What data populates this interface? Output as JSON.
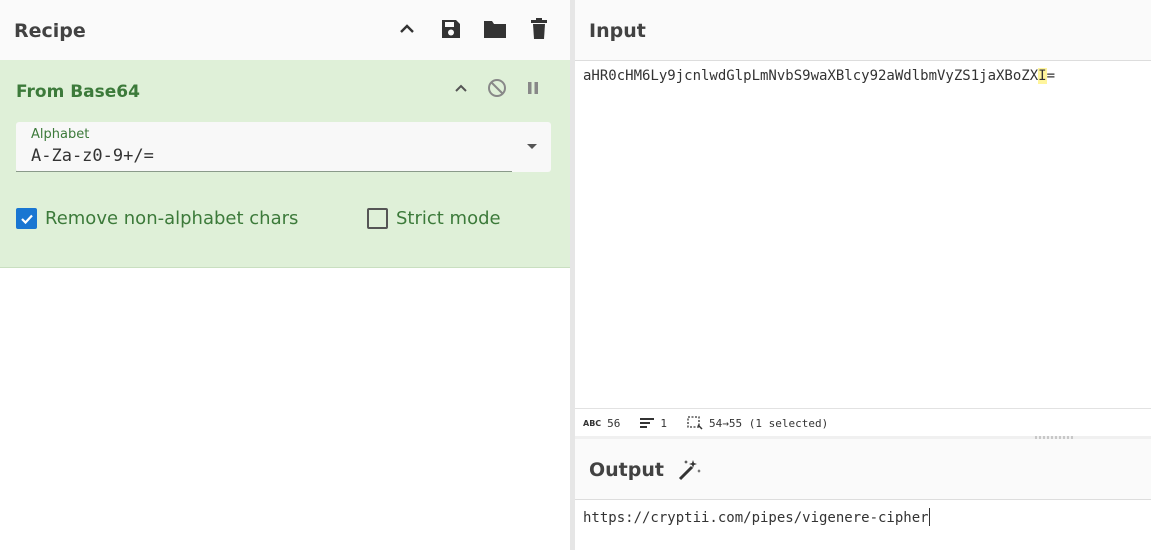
{
  "recipe": {
    "title": "Recipe",
    "icons": [
      "chevron-up-icon",
      "save-icon",
      "folder-icon",
      "trash-icon"
    ]
  },
  "operation": {
    "title": "From Base64",
    "alphabet_label": "Alphabet",
    "alphabet_value": "A-Za-z0-9+/=",
    "remove_non_alphabet_label": "Remove non-alphabet chars",
    "remove_non_alphabet_checked": true,
    "strict_mode_label": "Strict mode",
    "strict_mode_checked": false
  },
  "input": {
    "title": "Input",
    "text_before": "aHR0cHM6Ly9jcnlwdGlpLmNvbS9waXBlcy92aWdlbmVyZS1jaXBoZX",
    "text_selected": "I",
    "text_after": "="
  },
  "status": {
    "length": "56",
    "lines": "1",
    "selection": "54→55 (1 selected)"
  },
  "output": {
    "title": "Output",
    "text": "https://cryptii.com/pipes/vigenere-cipher"
  },
  "colors": {
    "operation_bg": "#dff0d8",
    "operation_text": "#3c7a3a",
    "checkbox_checked": "#1976d2",
    "selection_highlight": "#fff59d"
  }
}
